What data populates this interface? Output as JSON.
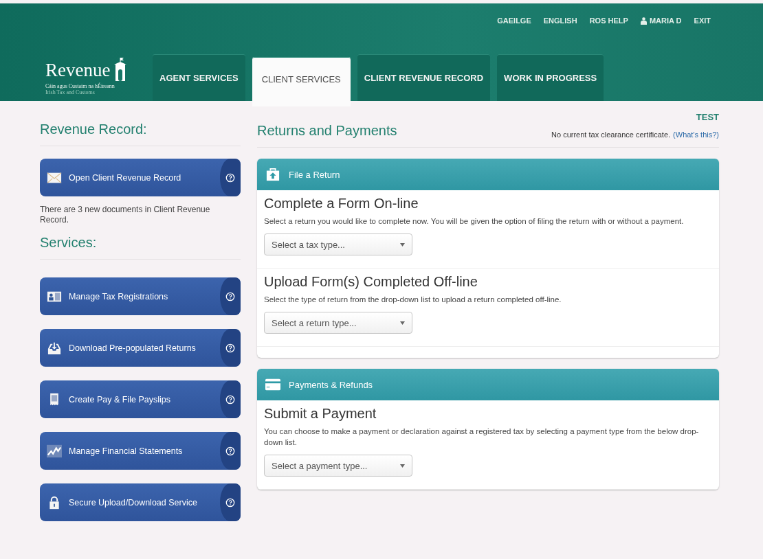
{
  "logo": {
    "name": "Revenue",
    "subtitle": "Cáin agus Custaim na hÉireann",
    "tagline": "Irish Tax and Customs"
  },
  "top_links": [
    {
      "label": "GAEILGE",
      "kind": "link"
    },
    {
      "label": "ENGLISH",
      "kind": "link"
    },
    {
      "label": "ROS HELP",
      "kind": "link"
    },
    {
      "label": "MARIA D",
      "kind": "user"
    },
    {
      "label": "EXIT",
      "kind": "link"
    }
  ],
  "tabs": [
    {
      "label": "AGENT SERVICES",
      "selected": false
    },
    {
      "label": "CLIENT SERVICES",
      "selected": true
    },
    {
      "label": "CLIENT REVENUE RECORD",
      "selected": false
    },
    {
      "label": "WORK IN PROGRESS",
      "selected": false
    }
  ],
  "sidebar": {
    "record_heading": "Revenue Record:",
    "record_button": {
      "label": "Open Client Revenue Record",
      "kind": "envelope"
    },
    "record_note": "There are 3 new documents in Client Revenue Record.",
    "services_heading": "Services:",
    "services": [
      {
        "label": "Manage Tax Registrations",
        "kind": "card"
      },
      {
        "label": "Download Pre-populated Returns",
        "kind": "tray"
      },
      {
        "label": "Create Pay & File Payslips",
        "kind": "receipt"
      },
      {
        "label": "Manage Financial Statements",
        "kind": "chart"
      },
      {
        "label": "Secure Upload/Download Service",
        "kind": "lock"
      }
    ]
  },
  "main": {
    "heading": "Returns and Payments",
    "env_label": "TEST",
    "clearance_note": "No current tax clearance certificate.",
    "clearance_link": "(What's this?)",
    "panels": [
      {
        "title": "File a Return",
        "kind": "upload",
        "sections": [
          {
            "title": "Complete a Form On-line",
            "description": "Select a return you would like to complete now. You will be given the option of filing the return with or without a payment.",
            "select": {
              "value": "Select a tax type..."
            }
          },
          {
            "title": "Upload Form(s) Completed Off-line",
            "description": "Select the type of return from the drop-down list to upload a return completed off-line.",
            "select": {
              "value": "Select a return type..."
            }
          }
        ]
      },
      {
        "title": "Payments & Refunds",
        "kind": "card",
        "sections": [
          {
            "title": "Submit a Payment",
            "description": "You can choose to make a payment or declaration against a registered tax by selecting a payment type from the below drop-down list.",
            "select": {
              "value": "Select a payment type..."
            }
          }
        ]
      }
    ]
  }
}
